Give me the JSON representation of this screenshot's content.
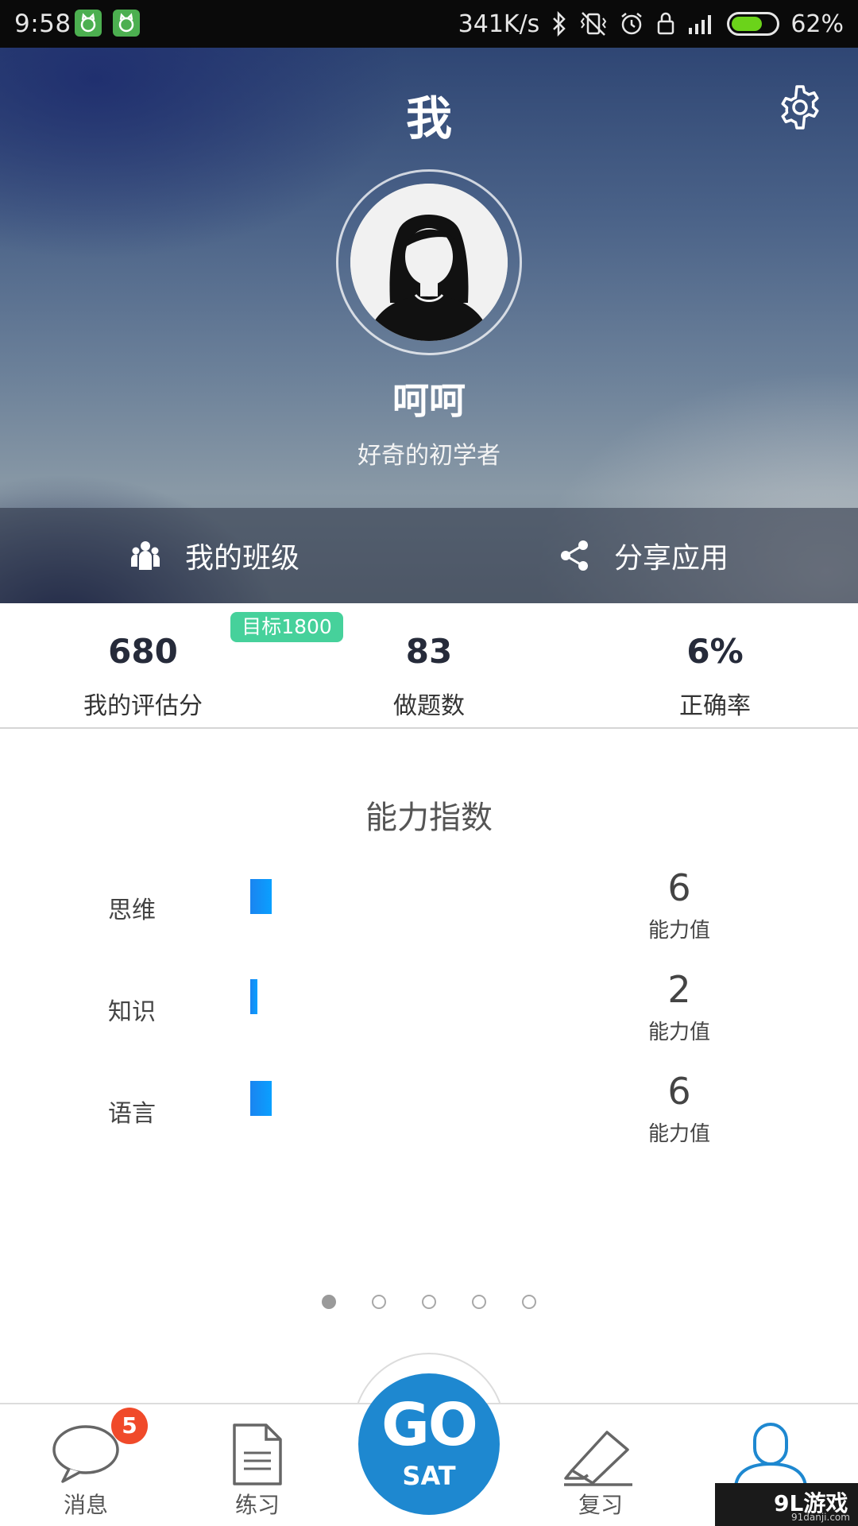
{
  "status_bar": {
    "time": "9:58",
    "net_speed": "341K/s",
    "battery_percent": "62%",
    "battery_level": 0.62,
    "icons": [
      "cat-notification-icon",
      "cat-notification-icon",
      "bluetooth-icon",
      "vibrate-off-icon",
      "alarm-icon",
      "lock-icon",
      "signal-icon",
      "battery-icon"
    ]
  },
  "header": {
    "title": "我"
  },
  "profile": {
    "name": "呵呵",
    "level": "好奇的初学者"
  },
  "actions": {
    "my_class": "我的班级",
    "share_app": "分享应用"
  },
  "stats": {
    "target_badge": "目标1800",
    "score": {
      "value": "680",
      "label": "我的评估分"
    },
    "questions": {
      "value": "83",
      "label": "做题数"
    },
    "accuracy": {
      "value": "6%",
      "label": "正确率"
    }
  },
  "ability": {
    "title": "能力指数",
    "unit": "能力值",
    "rows": [
      {
        "name": "思维",
        "value": "6"
      },
      {
        "name": "知识",
        "value": "2"
      },
      {
        "name": "语言",
        "value": "6"
      }
    ]
  },
  "pager": {
    "count": 5,
    "active_index": 0
  },
  "tabs": {
    "messages": "消息",
    "practice": "练习",
    "review": "复习",
    "message_badge": "5",
    "go_main": "GO",
    "go_sub": "SAT"
  },
  "watermark": {
    "main": "9L游戏",
    "sub": "91danji.com"
  },
  "colors": {
    "accent": "#1e88d0",
    "badge_green": "#46d19b",
    "badge_red": "#f04a2a",
    "bar_blue": "#1a84f0"
  }
}
